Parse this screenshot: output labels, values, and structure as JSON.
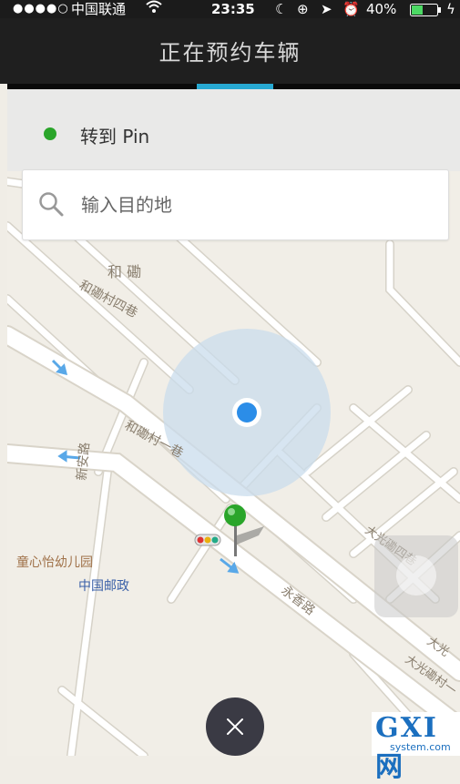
{
  "status_bar": {
    "signal": "●●●●○",
    "carrier": "中国联通",
    "time": "23:35",
    "battery": "40%"
  },
  "header": {
    "title": "正在预约车辆"
  },
  "pin": {
    "label": "转到 Pin"
  },
  "search": {
    "placeholder": "输入目的地"
  },
  "map": {
    "labels": [
      "和 磡",
      "和磡村四巷",
      "和磡村一巷",
      "新安路",
      "童心怡幼儿园",
      "中国邮政",
      "永香路",
      "大光磡四巷",
      "大光",
      "大光磡村一"
    ]
  },
  "watermark": {
    "big": "GXI网",
    "small": "system.com"
  },
  "colors": {
    "header_bg": "#1f1f1f",
    "accent": "#27a9d2",
    "location_dot": "#2b8de8",
    "pin_green": "#2aa52a",
    "close_button": "#3a3a44"
  }
}
